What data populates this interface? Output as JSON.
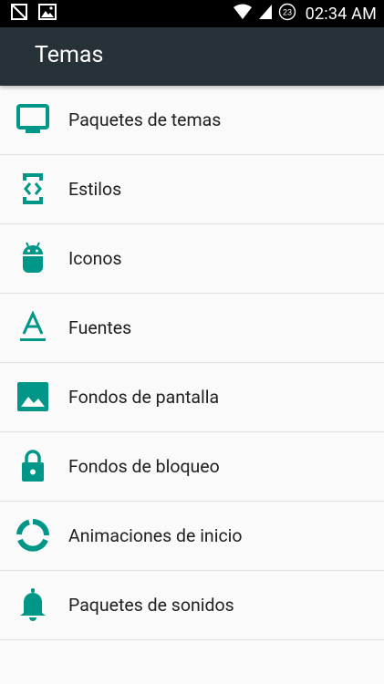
{
  "status_bar": {
    "time": "02:34 AM",
    "notification_count": "23",
    "icons": [
      "no-sim-icon",
      "image-notification-icon",
      "wifi-icon",
      "cellular-signal-icon",
      "notification-count-badge"
    ]
  },
  "app_bar": {
    "title": "Temas",
    "background": "#263238"
  },
  "accent_color": "#009688",
  "menu": {
    "items": [
      {
        "label": "Paquetes de temas",
        "icon": "monitor-icon"
      },
      {
        "label": "Estilos",
        "icon": "phone-code-icon"
      },
      {
        "label": "Iconos",
        "icon": "android-icon"
      },
      {
        "label": "Fuentes",
        "icon": "font-icon"
      },
      {
        "label": "Fondos de pantalla",
        "icon": "image-icon"
      },
      {
        "label": "Fondos de bloqueo",
        "icon": "lock-icon"
      },
      {
        "label": "Animaciones de inicio",
        "icon": "circle-progress-icon"
      },
      {
        "label": "Paquetes de sonidos",
        "icon": "bell-icon"
      }
    ]
  }
}
